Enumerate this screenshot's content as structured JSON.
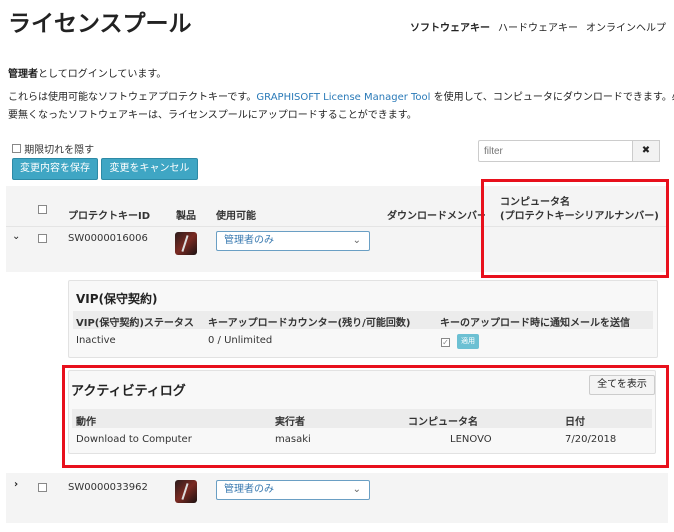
{
  "header": {
    "title": "ライセンスプール",
    "nav": [
      "ソフトウェアキー",
      "ハードウェアキー",
      "オンラインヘルプ"
    ]
  },
  "login": {
    "role": "管理者",
    "text": "としてログインしています。"
  },
  "intro": {
    "line1_pre": "これらは使用可能なソフトウェアプロテクトキーです。",
    "link": "GRAPHISOFT License Manager Tool",
    "line1_post": " を使用して、コンピュータにダウンロードできます。必",
    "line2": "要無くなったソフトウェアキーは、ライセンスプールにアップロードすることができます。"
  },
  "toolbar": {
    "hide_expired": "期限切れを隠す",
    "save": "変更内容を保存",
    "cancel": "変更をキャンセル",
    "filter_placeholder": "filter",
    "clear": "✖"
  },
  "table": {
    "headers": [
      "プロテクトキーID",
      "製品",
      "使用可能",
      "ダウンロードメンバー",
      "コンピュータ名",
      "(プロテクトキーシリアルナンバー)"
    ],
    "rows": [
      {
        "id": "SW0000016006",
        "availability": "管理者のみ",
        "expanded": true
      },
      {
        "id": "SW0000033962",
        "availability": "管理者のみ",
        "expanded": false
      }
    ]
  },
  "vip": {
    "title": "VIP(保守契約)",
    "headers": [
      "VIP(保守契約)ステータス",
      "キーアップロードカウンター(残り/可能回数)",
      "キーのアップロード時に通知メールを送信"
    ],
    "status": "Inactive",
    "counter": "0 / Unlimited",
    "notify_checked": true,
    "apply": "適用"
  },
  "activity": {
    "title": "アクティビティログ",
    "show_all": "全てを表示",
    "headers": [
      "動作",
      "実行者",
      "コンピュータ名",
      "日付"
    ],
    "rows": [
      {
        "action": "Download to Computer",
        "user": "masaki",
        "computer": "LENOVO",
        "date": "7/20/2018"
      }
    ]
  },
  "colors": {
    "accent": "#3fa6c4",
    "highlight": "#e8101c",
    "link": "#2a7ab8"
  }
}
